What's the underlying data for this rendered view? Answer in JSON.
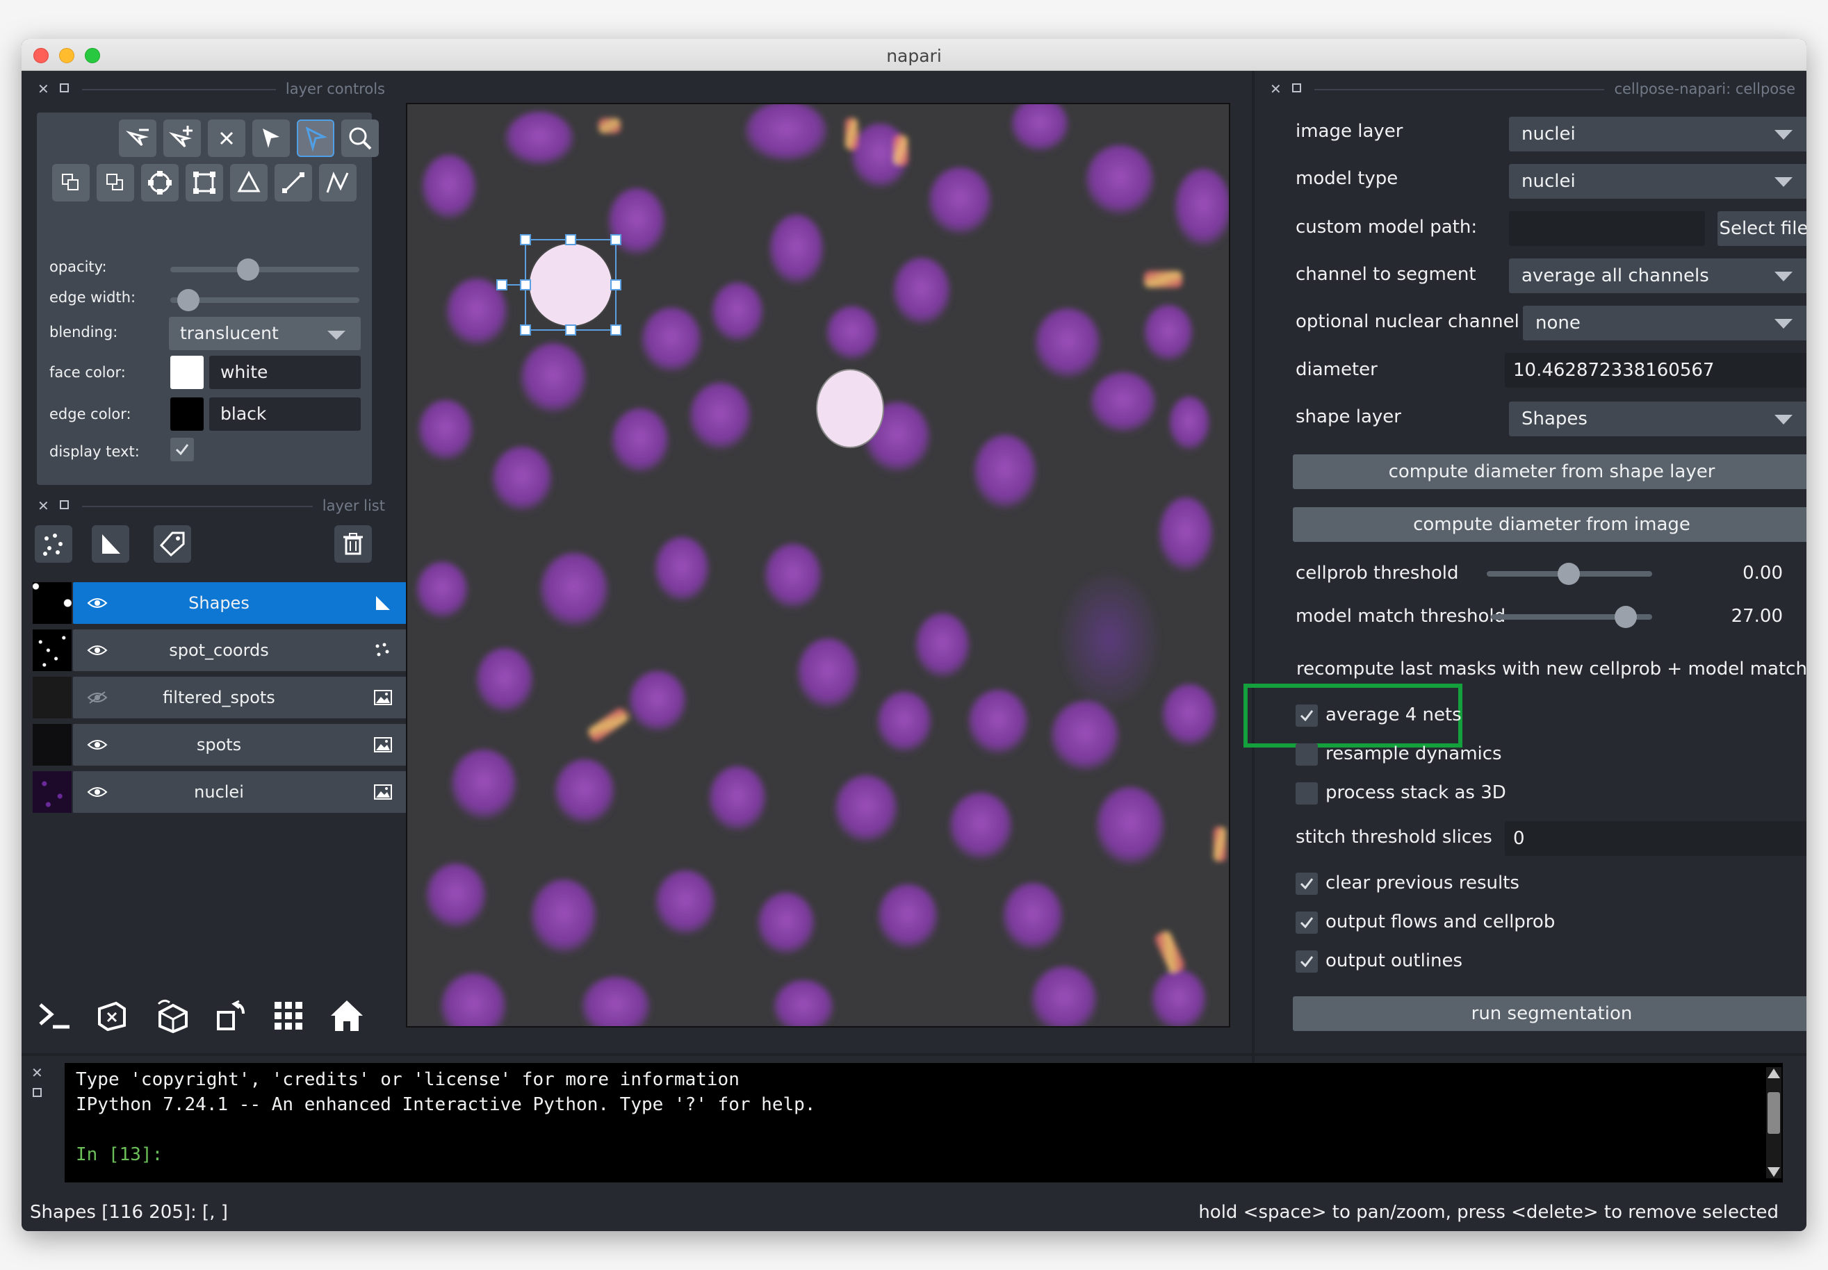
{
  "window": {
    "title": "napari"
  },
  "layer_controls": {
    "header": "layer controls",
    "opacity_label": "opacity:",
    "opacity_value": 0.5,
    "edge_width_label": "edge width:",
    "edge_width_value": 0.1,
    "blending_label": "blending:",
    "blending_value": "translucent",
    "face_color_label": "face color:",
    "face_color_value": "white",
    "face_color_swatch": "#ffffff",
    "edge_color_label": "edge color:",
    "edge_color_value": "black",
    "edge_color_swatch": "#000000",
    "display_text_label": "display text:"
  },
  "layer_list": {
    "header": "layer list",
    "layers": [
      {
        "name": "Shapes",
        "visible": true,
        "selected": true,
        "type_icon": "shapes-icon"
      },
      {
        "name": "spot_coords",
        "visible": true,
        "selected": false,
        "type_icon": "points-icon"
      },
      {
        "name": "filtered_spots",
        "visible": false,
        "selected": false,
        "type_icon": "image-icon"
      },
      {
        "name": "spots",
        "visible": true,
        "selected": false,
        "type_icon": "image-icon"
      },
      {
        "name": "nuclei",
        "visible": true,
        "selected": false,
        "type_icon": "image-icon"
      }
    ]
  },
  "cellpose": {
    "header": "cellpose-napari: cellpose",
    "image_layer_label": "image layer",
    "image_layer_value": "nuclei",
    "model_type_label": "model type",
    "model_type_value": "nuclei",
    "custom_model_label": "custom model path:",
    "custom_model_value": "",
    "select_file_label": "Select file",
    "channel_label": "channel to segment",
    "channel_value": "average all channels",
    "nuclear_channel_label": "optional nuclear channel",
    "nuclear_channel_value": "none",
    "diameter_label": "diameter",
    "diameter_value": "10.462872338160567",
    "shape_layer_label": "shape layer",
    "shape_layer_value": "Shapes",
    "compute_shape_label": "compute diameter from shape layer",
    "compute_image_label": "compute diameter from image",
    "cellprob_label": "cellprob threshold",
    "cellprob_value": "0.00",
    "model_match_label": "model match threshold",
    "model_match_value": "27.00",
    "recompute_label": "recompute last masks with new cellprob + model match",
    "avg4_label": "average 4 nets",
    "resample_label": "resample dynamics",
    "stack3d_label": "process stack as 3D",
    "stitch_label": "stitch threshold slices",
    "stitch_value": "0",
    "clear_label": "clear previous results",
    "flows_label": "output flows and cellprob",
    "outlines_label": "output outlines",
    "run_label": "run segmentation"
  },
  "console": {
    "line1": "Type 'copyright', 'credits' or 'license' for more information",
    "line2": "IPython 7.24.1 -- An enhanced Interactive Python. Type '?' for help.",
    "prompt": "In [13]:"
  },
  "status": {
    "left": "Shapes [116 205]: [, ]",
    "right": "hold <space> to pan/zoom, press <delete> to remove selected"
  },
  "colors": {
    "accent": "#0e77d4",
    "highlight": "#14a03c",
    "bg": "#262930"
  }
}
